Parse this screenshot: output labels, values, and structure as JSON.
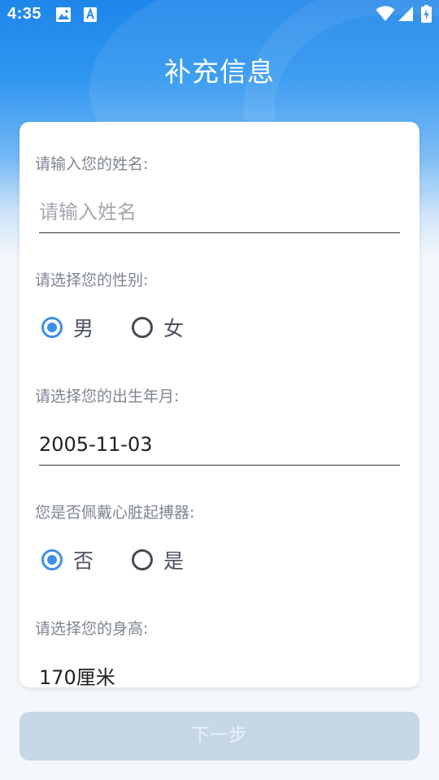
{
  "status_bar": {
    "time": "4:35",
    "left_icons": [
      "gallery-icon",
      "text-app-icon"
    ],
    "right_icons": [
      "wifi-icon",
      "signal-icon",
      "battery-charging-icon"
    ]
  },
  "header": {
    "title": "补充信息"
  },
  "form": {
    "name": {
      "label": "请输入您的姓名:",
      "placeholder": "请输入姓名",
      "value": ""
    },
    "gender": {
      "label": "请选择您的性别:",
      "options": [
        {
          "label": "男",
          "checked": true
        },
        {
          "label": "女",
          "checked": false
        }
      ]
    },
    "birth": {
      "label": "请选择您的出生年月:",
      "value": "2005-11-03"
    },
    "pacemaker": {
      "label": "您是否佩戴心脏起搏器:",
      "options": [
        {
          "label": "否",
          "checked": true
        },
        {
          "label": "是",
          "checked": false
        }
      ]
    },
    "height": {
      "label": "请选择您的身高:",
      "value": "170厘米"
    }
  },
  "next_button": {
    "label": "下一步",
    "enabled": false
  },
  "colors": {
    "primary": "#1e86ea",
    "radio_checked": "#3f8fe8",
    "button_disabled": "#c6d7e8"
  }
}
